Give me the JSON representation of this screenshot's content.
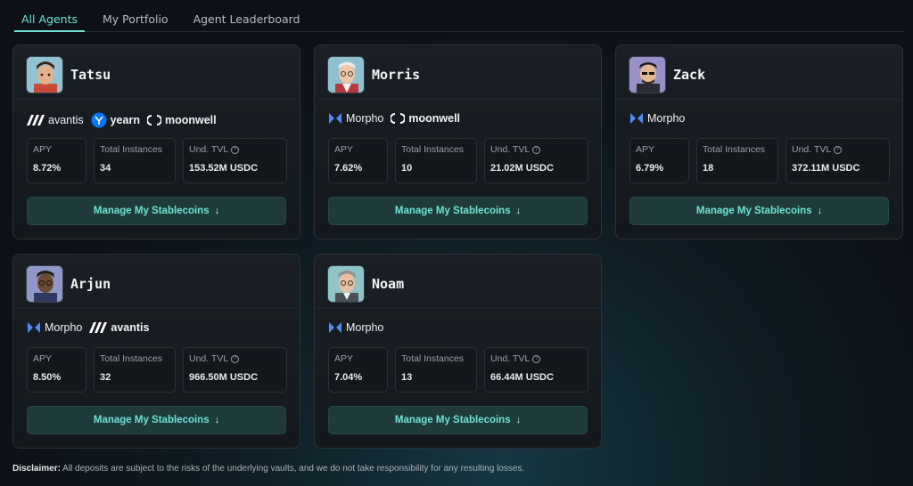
{
  "tabs": [
    {
      "label": "All Agents",
      "active": true
    },
    {
      "label": "My Portfolio",
      "active": false
    },
    {
      "label": "Agent Leaderboard",
      "active": false
    }
  ],
  "stat_labels": {
    "apy": "APY",
    "instances": "Total Instances",
    "tvl": "Und. TVL"
  },
  "manage_label": "Manage My Stablecoins",
  "protocol_names": {
    "avantis": "avantis",
    "yearn": "yearn",
    "moonwell": "moonwell",
    "morpho": "Morpho"
  },
  "agents": [
    {
      "name": "Tatsu",
      "apy": "8.72%",
      "instances": "34",
      "tvl": "153.52M USDC"
    },
    {
      "name": "Morris",
      "apy": "7.62%",
      "instances": "10",
      "tvl": "21.02M USDC"
    },
    {
      "name": "Zack",
      "apy": "6.79%",
      "instances": "18",
      "tvl": "372.11M USDC"
    },
    {
      "name": "Arjun",
      "apy": "8.50%",
      "instances": "32",
      "tvl": "966.50M USDC"
    },
    {
      "name": "Noam",
      "apy": "7.04%",
      "instances": "13",
      "tvl": "66.44M USDC"
    }
  ],
  "disclaimer": {
    "label": "Disclaimer:",
    "text": "All deposits are subject to the risks of the underlying vaults, and we do not take responsibility for any resulting losses."
  },
  "colors": {
    "accent": "#6fe3d3",
    "button_bg": "#1e3a3b",
    "morpho": "#4d8cf5",
    "yearn": "#0675f9"
  },
  "icons": [
    "avantis-icon",
    "yearn-icon",
    "moonwell-icon",
    "morpho-icon",
    "info-icon",
    "arrow-down-icon"
  ]
}
